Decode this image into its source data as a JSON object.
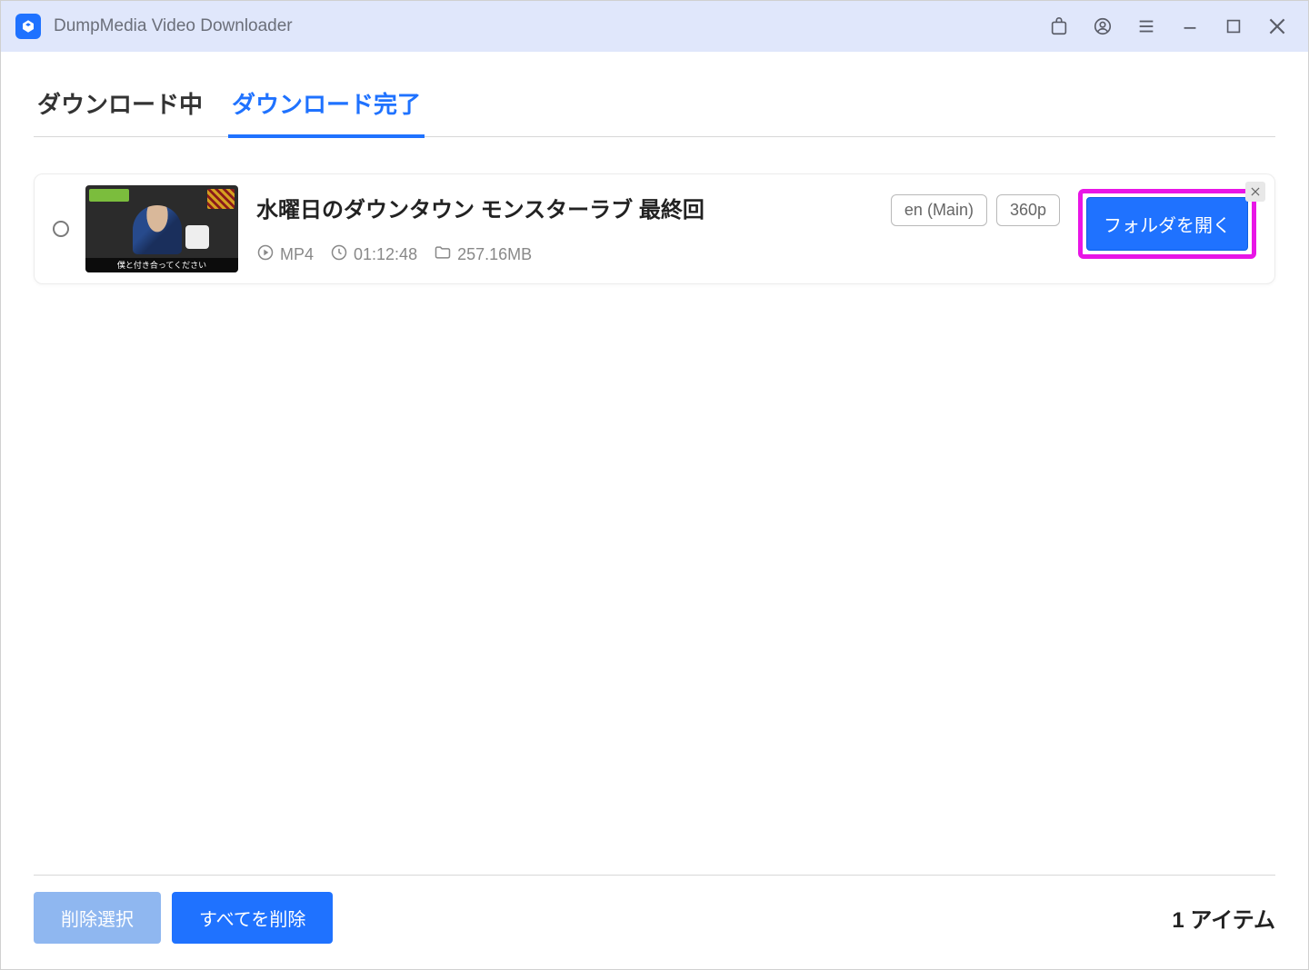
{
  "app": {
    "title": "DumpMedia Video Downloader"
  },
  "tabs": {
    "downloading": "ダウンロード中",
    "completed": "ダウンロード完了"
  },
  "item": {
    "title": "水曜日のダウンタウン モンスターラブ 最終回",
    "format": "MP4",
    "duration": "01:12:48",
    "size": "257.16MB",
    "lang_badge": "en (Main)",
    "quality_badge": "360p",
    "open_folder": "フォルダを開く",
    "thumb_subtitle": "僕と付き合ってください"
  },
  "footer": {
    "delete_selected": "削除選択",
    "delete_all": "すべてを削除",
    "item_count": "1 アイテム"
  }
}
